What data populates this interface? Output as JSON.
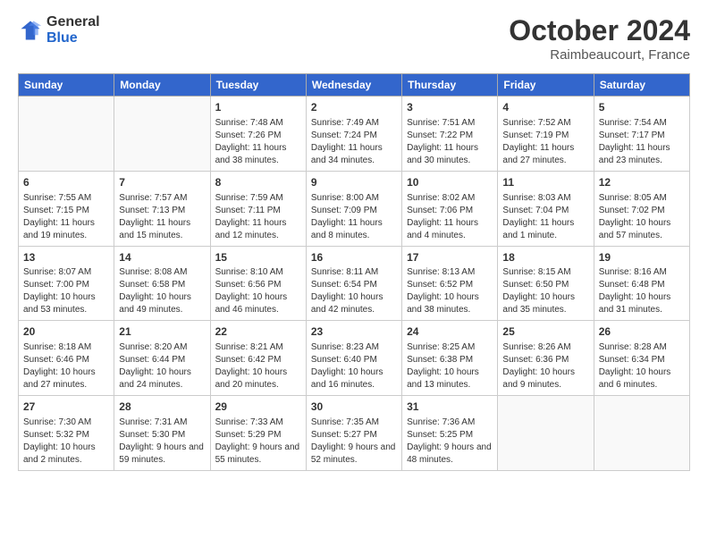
{
  "header": {
    "logo_general": "General",
    "logo_blue": "Blue",
    "month": "October 2024",
    "location": "Raimbeaucourt, France"
  },
  "days_of_week": [
    "Sunday",
    "Monday",
    "Tuesday",
    "Wednesday",
    "Thursday",
    "Friday",
    "Saturday"
  ],
  "weeks": [
    [
      {
        "day": "",
        "info": ""
      },
      {
        "day": "",
        "info": ""
      },
      {
        "day": "1",
        "info": "Sunrise: 7:48 AM\nSunset: 7:26 PM\nDaylight: 11 hours and 38 minutes."
      },
      {
        "day": "2",
        "info": "Sunrise: 7:49 AM\nSunset: 7:24 PM\nDaylight: 11 hours and 34 minutes."
      },
      {
        "day": "3",
        "info": "Sunrise: 7:51 AM\nSunset: 7:22 PM\nDaylight: 11 hours and 30 minutes."
      },
      {
        "day": "4",
        "info": "Sunrise: 7:52 AM\nSunset: 7:19 PM\nDaylight: 11 hours and 27 minutes."
      },
      {
        "day": "5",
        "info": "Sunrise: 7:54 AM\nSunset: 7:17 PM\nDaylight: 11 hours and 23 minutes."
      }
    ],
    [
      {
        "day": "6",
        "info": "Sunrise: 7:55 AM\nSunset: 7:15 PM\nDaylight: 11 hours and 19 minutes."
      },
      {
        "day": "7",
        "info": "Sunrise: 7:57 AM\nSunset: 7:13 PM\nDaylight: 11 hours and 15 minutes."
      },
      {
        "day": "8",
        "info": "Sunrise: 7:59 AM\nSunset: 7:11 PM\nDaylight: 11 hours and 12 minutes."
      },
      {
        "day": "9",
        "info": "Sunrise: 8:00 AM\nSunset: 7:09 PM\nDaylight: 11 hours and 8 minutes."
      },
      {
        "day": "10",
        "info": "Sunrise: 8:02 AM\nSunset: 7:06 PM\nDaylight: 11 hours and 4 minutes."
      },
      {
        "day": "11",
        "info": "Sunrise: 8:03 AM\nSunset: 7:04 PM\nDaylight: 11 hours and 1 minute."
      },
      {
        "day": "12",
        "info": "Sunrise: 8:05 AM\nSunset: 7:02 PM\nDaylight: 10 hours and 57 minutes."
      }
    ],
    [
      {
        "day": "13",
        "info": "Sunrise: 8:07 AM\nSunset: 7:00 PM\nDaylight: 10 hours and 53 minutes."
      },
      {
        "day": "14",
        "info": "Sunrise: 8:08 AM\nSunset: 6:58 PM\nDaylight: 10 hours and 49 minutes."
      },
      {
        "day": "15",
        "info": "Sunrise: 8:10 AM\nSunset: 6:56 PM\nDaylight: 10 hours and 46 minutes."
      },
      {
        "day": "16",
        "info": "Sunrise: 8:11 AM\nSunset: 6:54 PM\nDaylight: 10 hours and 42 minutes."
      },
      {
        "day": "17",
        "info": "Sunrise: 8:13 AM\nSunset: 6:52 PM\nDaylight: 10 hours and 38 minutes."
      },
      {
        "day": "18",
        "info": "Sunrise: 8:15 AM\nSunset: 6:50 PM\nDaylight: 10 hours and 35 minutes."
      },
      {
        "day": "19",
        "info": "Sunrise: 8:16 AM\nSunset: 6:48 PM\nDaylight: 10 hours and 31 minutes."
      }
    ],
    [
      {
        "day": "20",
        "info": "Sunrise: 8:18 AM\nSunset: 6:46 PM\nDaylight: 10 hours and 27 minutes."
      },
      {
        "day": "21",
        "info": "Sunrise: 8:20 AM\nSunset: 6:44 PM\nDaylight: 10 hours and 24 minutes."
      },
      {
        "day": "22",
        "info": "Sunrise: 8:21 AM\nSunset: 6:42 PM\nDaylight: 10 hours and 20 minutes."
      },
      {
        "day": "23",
        "info": "Sunrise: 8:23 AM\nSunset: 6:40 PM\nDaylight: 10 hours and 16 minutes."
      },
      {
        "day": "24",
        "info": "Sunrise: 8:25 AM\nSunset: 6:38 PM\nDaylight: 10 hours and 13 minutes."
      },
      {
        "day": "25",
        "info": "Sunrise: 8:26 AM\nSunset: 6:36 PM\nDaylight: 10 hours and 9 minutes."
      },
      {
        "day": "26",
        "info": "Sunrise: 8:28 AM\nSunset: 6:34 PM\nDaylight: 10 hours and 6 minutes."
      }
    ],
    [
      {
        "day": "27",
        "info": "Sunrise: 7:30 AM\nSunset: 5:32 PM\nDaylight: 10 hours and 2 minutes."
      },
      {
        "day": "28",
        "info": "Sunrise: 7:31 AM\nSunset: 5:30 PM\nDaylight: 9 hours and 59 minutes."
      },
      {
        "day": "29",
        "info": "Sunrise: 7:33 AM\nSunset: 5:29 PM\nDaylight: 9 hours and 55 minutes."
      },
      {
        "day": "30",
        "info": "Sunrise: 7:35 AM\nSunset: 5:27 PM\nDaylight: 9 hours and 52 minutes."
      },
      {
        "day": "31",
        "info": "Sunrise: 7:36 AM\nSunset: 5:25 PM\nDaylight: 9 hours and 48 minutes."
      },
      {
        "day": "",
        "info": ""
      },
      {
        "day": "",
        "info": ""
      }
    ]
  ]
}
